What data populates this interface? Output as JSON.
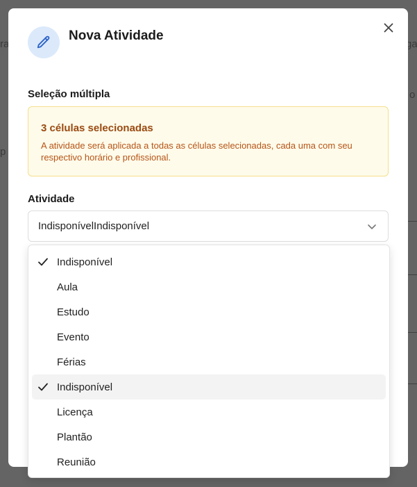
{
  "background": {
    "fragments": [
      "ra",
      "ga",
      "p",
      "o"
    ]
  },
  "modal": {
    "title": "Nova Atividade",
    "header_icon": "pencil-icon",
    "close_icon": "close-icon",
    "multi_section": {
      "label": "Seleção múltipla",
      "notice_title": "3 células selecionadas",
      "notice_text": "A atividade será aplicada a todas as células selecionadas, cada uma com seu respectivo horário e profissional."
    },
    "activity": {
      "label": "Atividade",
      "selected_value": "IndisponívelIndisponível",
      "options": [
        {
          "label": "Indisponível",
          "checked": true,
          "highlighted": false
        },
        {
          "label": "Aula",
          "checked": false,
          "highlighted": false
        },
        {
          "label": "Estudo",
          "checked": false,
          "highlighted": false
        },
        {
          "label": "Evento",
          "checked": false,
          "highlighted": false
        },
        {
          "label": "Férias",
          "checked": false,
          "highlighted": false
        },
        {
          "label": "Indisponível",
          "checked": true,
          "highlighted": true
        },
        {
          "label": "Licença",
          "checked": false,
          "highlighted": false
        },
        {
          "label": "Plantão",
          "checked": false,
          "highlighted": false
        },
        {
          "label": "Reunião",
          "checked": false,
          "highlighted": false
        }
      ]
    }
  },
  "colors": {
    "accent_icon": "#2d64c8",
    "notice_bg": "#fefbea",
    "notice_border": "#f5df8c",
    "notice_text": "#b65417"
  }
}
